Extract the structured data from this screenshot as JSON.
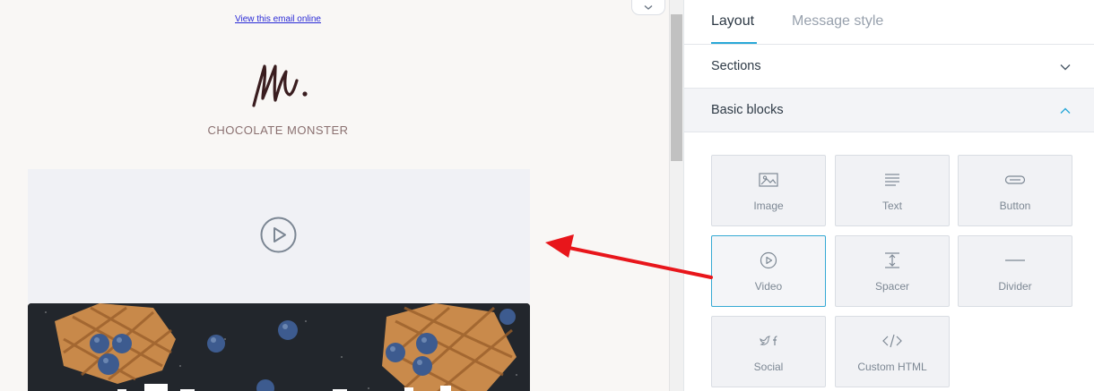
{
  "preview": {
    "view_online_link": "View this email online",
    "brand_name": "CHOCOLATE MONSTER"
  },
  "panel": {
    "tabs": [
      {
        "label": "Layout",
        "active": true
      },
      {
        "label": "Message style",
        "active": false
      }
    ],
    "sections": {
      "title": "Sections",
      "expanded": false
    },
    "basic_blocks": {
      "title": "Basic blocks",
      "expanded": true,
      "items": [
        {
          "label": "Image",
          "icon": "image-icon"
        },
        {
          "label": "Text",
          "icon": "text-icon"
        },
        {
          "label": "Button",
          "icon": "button-icon"
        },
        {
          "label": "Video",
          "icon": "video-icon",
          "active": true
        },
        {
          "label": "Spacer",
          "icon": "spacer-icon"
        },
        {
          "label": "Divider",
          "icon": "divider-icon"
        },
        {
          "label": "Social",
          "icon": "social-icon"
        },
        {
          "label": "Custom HTML",
          "icon": "code-icon"
        }
      ]
    }
  },
  "colors": {
    "accent": "#29a8d8",
    "annotation_arrow": "#e8161b",
    "preview_bg": "#f9f7f5",
    "block_bg": "#f1f2f5"
  }
}
